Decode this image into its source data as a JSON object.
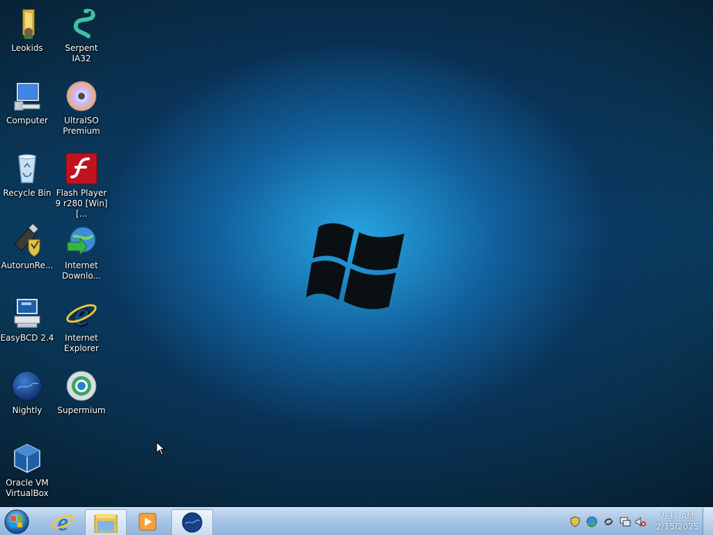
{
  "desktop": {
    "icons": [
      {
        "id": "leokids",
        "label": "Leokids",
        "icon": "folder-user-icon"
      },
      {
        "id": "serpent",
        "label": "Serpent IA32",
        "icon": "serpent-icon"
      },
      {
        "id": "computer",
        "label": "Computer",
        "icon": "computer-icon"
      },
      {
        "id": "ultraiso",
        "label": "UltraISO Premium",
        "icon": "disc-icon"
      },
      {
        "id": "recycle",
        "label": "Recycle Bin",
        "icon": "recycle-bin-icon"
      },
      {
        "id": "flash",
        "label": "Flash Player 9 r280 [Win] [...",
        "icon": "flash-icon"
      },
      {
        "id": "autorun",
        "label": "AutorunRe...",
        "icon": "usb-shield-icon"
      },
      {
        "id": "idm",
        "label": "Internet Downlo...",
        "icon": "globe-download-icon"
      },
      {
        "id": "easybcd",
        "label": "EasyBCD 2.4",
        "icon": "easybcd-icon"
      },
      {
        "id": "ie",
        "label": "Internet Explorer",
        "icon": "internet-explorer-icon"
      },
      {
        "id": "nightly",
        "label": "Nightly",
        "icon": "nightly-globe-icon"
      },
      {
        "id": "supermium",
        "label": "Supermium",
        "icon": "supermium-icon"
      },
      {
        "id": "virtualbox",
        "label": "Oracle VM VirtualBox",
        "icon": "virtualbox-icon"
      }
    ]
  },
  "taskbar": {
    "start_button": "start-orb-icon",
    "pinned": [
      "internet-explorer-icon",
      "file-explorer-icon",
      "media-player-icon",
      "nightly-globe-icon"
    ],
    "tray": {
      "icons": [
        "shield-icon",
        "network-globe-icon",
        "sync-icon",
        "display-icon",
        "volume-muted-icon"
      ],
      "time": "7:37 AM",
      "date": "2/15/2025"
    }
  },
  "colors": {
    "desktop_accent": "#1a8fd0",
    "taskbar": "#a9c6e6"
  }
}
